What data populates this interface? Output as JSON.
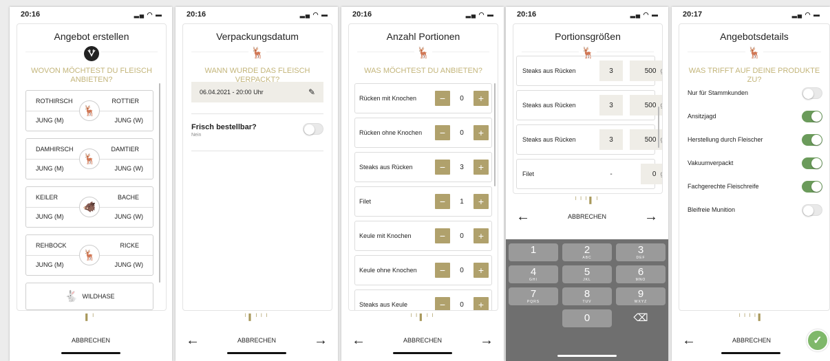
{
  "colors": {
    "accent": "#a9995c",
    "step_button": "#b0a16c",
    "toggle_on": "#6b9b5b",
    "confirm": "#7fb86a"
  },
  "screens": {
    "s1": {
      "time": "20:16",
      "title": "Angebot erstellen",
      "subtitle": "WOVON MÖCHTEST DU FLEISCH ANBIETEN?",
      "species": [
        {
          "tl": "ROTHIRSCH",
          "tr": "ROTTIER",
          "bl": "JUNG (M)",
          "br": "JUNG (W)",
          "icon": "deer-icon"
        },
        {
          "tl": "DAMHIRSCH",
          "tr": "DAMTIER",
          "bl": "JUNG (M)",
          "br": "JUNG (W)",
          "icon": "fallow-deer-icon"
        },
        {
          "tl": "KEILER",
          "tr": "BACHE",
          "bl": "JUNG (M)",
          "br": "JUNG (W)",
          "icon": "boar-icon"
        },
        {
          "tl": "REHBOCK",
          "tr": "RICKE",
          "bl": "JUNG (M)",
          "br": "JUNG (W)",
          "icon": "roe-deer-icon"
        }
      ],
      "hare": "WILDHASE",
      "cancel": "ABBRECHEN"
    },
    "s2": {
      "time": "20:16",
      "title": "Verpackungsdatum",
      "subtitle": "WANN WURDE DAS FLEISCH VERPACKT?",
      "date_value": "06.04.2021 - 20:00 Uhr",
      "frisch_label": "Frisch bestellbar?",
      "frisch_sub": "Nein",
      "cancel": "ABBRECHEN"
    },
    "s3": {
      "time": "20:16",
      "title": "Anzahl Portionen",
      "subtitle": "WAS MÖCHTEST DU ANBIETEN?",
      "rows": [
        {
          "label": "Rücken mit Knochen",
          "value": "0"
        },
        {
          "label": "Rücken ohne Knochen",
          "value": "0"
        },
        {
          "label": "Steaks aus Rücken",
          "value": "3"
        },
        {
          "label": "Filet",
          "value": "1"
        },
        {
          "label": "Keule mit Knochen",
          "value": "0"
        },
        {
          "label": "Keule ohne Knochen",
          "value": "0"
        },
        {
          "label": "Steaks aus Keule",
          "value": "0"
        }
      ],
      "cancel": "ABBRECHEN"
    },
    "s4": {
      "time": "20:16",
      "title": "Portionsgrößen",
      "rows": [
        {
          "label": "Steaks aus Rücken",
          "qty": "3",
          "weight": "500",
          "unit": "g"
        },
        {
          "label": "Steaks aus Rücken",
          "qty": "3",
          "weight": "500",
          "unit": "g"
        },
        {
          "label": "Steaks aus Rücken",
          "qty": "3",
          "weight": "500",
          "unit": "g"
        },
        {
          "label": "Filet",
          "qty": "-",
          "weight": "0",
          "unit": "g"
        }
      ],
      "cancel": "ABBRECHEN",
      "keys": [
        {
          "d": "1",
          "l": ""
        },
        {
          "d": "2",
          "l": "ABC"
        },
        {
          "d": "3",
          "l": "DEF"
        },
        {
          "d": "4",
          "l": "GHI"
        },
        {
          "d": "5",
          "l": "JKL"
        },
        {
          "d": "6",
          "l": "MNO"
        },
        {
          "d": "7",
          "l": "PQRS"
        },
        {
          "d": "8",
          "l": "TUV"
        },
        {
          "d": "9",
          "l": "WXYZ"
        },
        {
          "d": "0",
          "l": ""
        }
      ],
      "backspace": "⌫"
    },
    "s5": {
      "time": "20:17",
      "title": "Angebotsdetails",
      "subtitle": "WAS TRIFFT AUF DEINE PRODUKTE ZU?",
      "rows": [
        {
          "label": "Nur für Stammkunden",
          "on": false
        },
        {
          "label": "Ansitzjagd",
          "on": true
        },
        {
          "label": "Herstellung durch Fleischer",
          "on": true
        },
        {
          "label": "Vakuumverpackt",
          "on": true
        },
        {
          "label": "Fachgerechte Fleischreife",
          "on": true
        },
        {
          "label": "Bleifreie Munition",
          "on": false
        }
      ],
      "cancel": "ABBRECHEN"
    }
  }
}
